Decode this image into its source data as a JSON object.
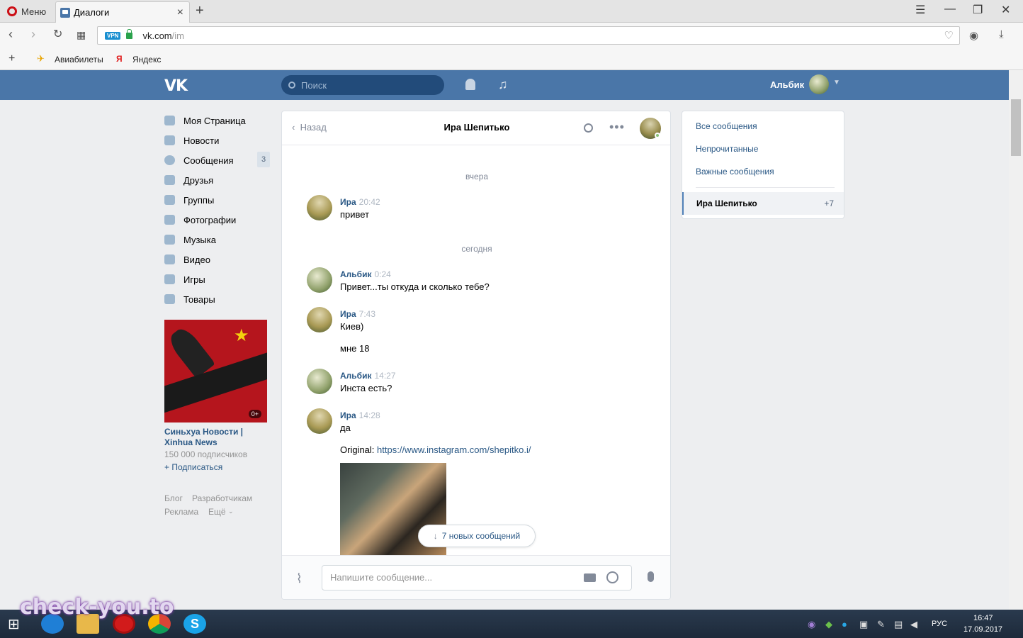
{
  "browser": {
    "menu_label": "Меню",
    "tab_title": "Диалоги",
    "url_host": "vk.com",
    "url_path": "/im",
    "vpn_badge": "VPN",
    "bookmarks": [
      "Авиабилеты",
      "Яндекс"
    ]
  },
  "header": {
    "logo": "VK",
    "search_placeholder": "Поиск",
    "user_name": "Альбик"
  },
  "sidebar": {
    "items": [
      {
        "label": "Моя Страница",
        "icon": "home-icon"
      },
      {
        "label": "Новости",
        "icon": "news-icon"
      },
      {
        "label": "Сообщения",
        "icon": "messages-icon",
        "badge": "3"
      },
      {
        "label": "Друзья",
        "icon": "friends-icon"
      },
      {
        "label": "Группы",
        "icon": "groups-icon"
      },
      {
        "label": "Фотографии",
        "icon": "camera-icon"
      },
      {
        "label": "Музыка",
        "icon": "music-icon"
      },
      {
        "label": "Видео",
        "icon": "video-icon"
      },
      {
        "label": "Игры",
        "icon": "gamepad-icon"
      },
      {
        "label": "Товары",
        "icon": "bag-icon"
      }
    ],
    "ad": {
      "title": "Синьхуа Новости | Xinhua News",
      "subscribers": "150 000 подписчиков",
      "subscribe": "+ Подписаться",
      "age": "0+"
    },
    "footer": {
      "blog": "Блог",
      "devs": "Разработчикам",
      "ads": "Реклама",
      "more": "Ещё"
    }
  },
  "chat": {
    "back": "Назад",
    "title": "Ира Шепитько",
    "days": [
      "вчера",
      "сегодня"
    ],
    "messages": [
      {
        "author": "Ира",
        "time": "20:42",
        "text": "привет"
      },
      {
        "author": "Альбик",
        "time": "0:24",
        "text": "Привет...ты откуда и сколько тебе?"
      },
      {
        "author": "Ира",
        "time": "7:43",
        "text": "Киев)",
        "text2": "мне 18"
      },
      {
        "author": "Альбик",
        "time": "14:27",
        "text": "Инста есть?"
      },
      {
        "author": "Ира",
        "time": "14:28",
        "text": "да",
        "text2_prefix": "Original: ",
        "link": "https://www.instagram.com/shepitko.i/"
      }
    ],
    "new_messages": "7 новых сообщений",
    "input_placeholder": "Напишите сообщение..."
  },
  "right_panel": {
    "links": [
      "Все сообщения",
      "Непрочитанные",
      "Важные сообщения"
    ],
    "active_dialog": "Ира Шепитько",
    "active_count": "+7"
  },
  "taskbar": {
    "lang": "РУС",
    "time": "16:47",
    "date": "17.09.2017",
    "watermark": "check-you.to"
  }
}
